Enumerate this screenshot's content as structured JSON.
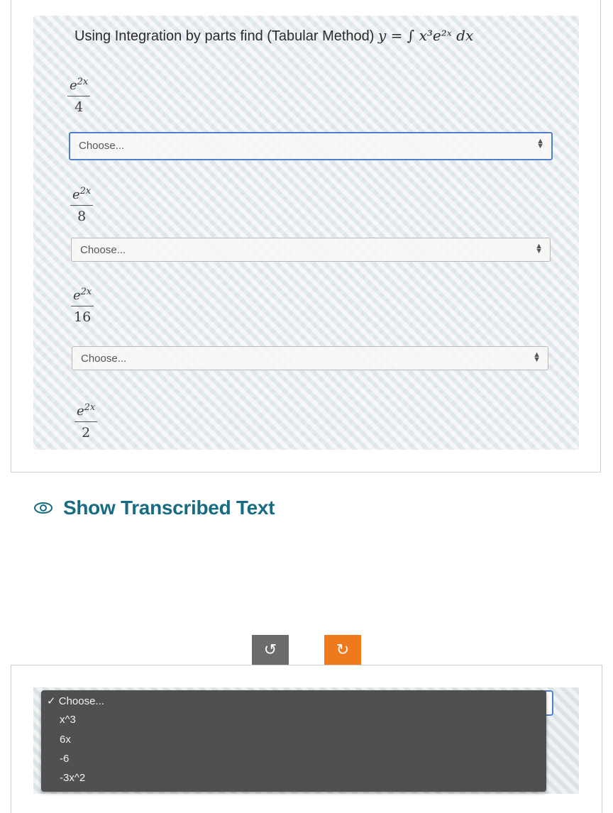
{
  "question": {
    "text": "Using Integration by parts find (Tabular Method)",
    "equation": "y = ∫ x³e²ˣ dx"
  },
  "fractions": [
    {
      "numerator": "e",
      "exponent": "2x",
      "denominator": "4"
    },
    {
      "numerator": "e",
      "exponent": "2x",
      "denominator": "8"
    },
    {
      "numerator": "e",
      "exponent": "2x",
      "denominator": "16"
    },
    {
      "numerator": "e",
      "exponent": "2x",
      "denominator": "2"
    }
  ],
  "selects": [
    {
      "value": "Choose..."
    },
    {
      "value": "Choose..."
    },
    {
      "value": "Choose..."
    }
  ],
  "transcribed_link": "Show Transcribed Text",
  "controls": {
    "rotate_left_color": "#6b6b6b",
    "rotate_right_color": "#ee7a1c"
  },
  "dropdown": {
    "selected": "✓ Choose...",
    "options": [
      "x^3",
      "6x",
      "-6",
      "-3x^2"
    ]
  }
}
